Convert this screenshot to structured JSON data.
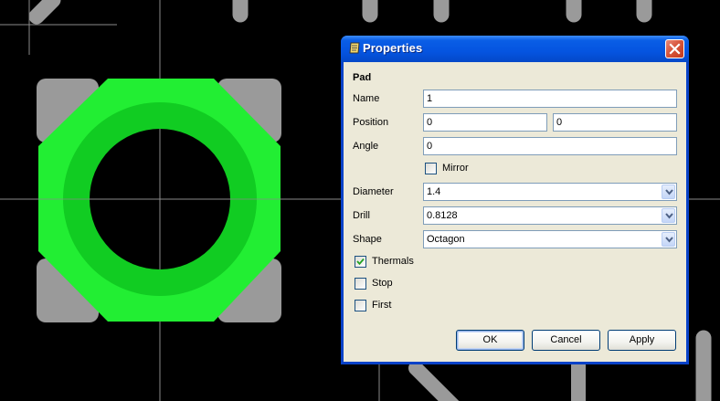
{
  "dialog": {
    "title": "Properties",
    "section": "Pad",
    "fields": {
      "name_label": "Name",
      "name_value": "1",
      "position_label": "Position",
      "position_x": "0",
      "position_y": "0",
      "angle_label": "Angle",
      "angle_value": "0",
      "mirror_label": "Mirror",
      "mirror_checked": false,
      "diameter_label": "Diameter",
      "diameter_value": "1.4",
      "drill_label": "Drill",
      "drill_value": "0.8128",
      "shape_label": "Shape",
      "shape_value": "Octagon",
      "thermals_label": "Thermals",
      "thermals_checked": true,
      "stop_label": "Stop",
      "stop_checked": false,
      "first_label": "First",
      "first_checked": false
    },
    "buttons": {
      "ok": "OK",
      "cancel": "Cancel",
      "apply": "Apply"
    }
  },
  "colors": {
    "background": "#000000",
    "pad_copper": "#22ee33",
    "pad_ring": "#11cc22",
    "smd_pads": "#9a9a9a",
    "traces": "#9a9a9a",
    "crosshair": "#888888",
    "titlebar": "#0a5ee6",
    "dialog_face": "#ece9d8"
  },
  "icons": {
    "title_icon": "pad-properties-icon",
    "close_icon": "close-icon",
    "dropdown_icon": "chevron-down-icon",
    "check_icon": "checkmark-icon"
  }
}
